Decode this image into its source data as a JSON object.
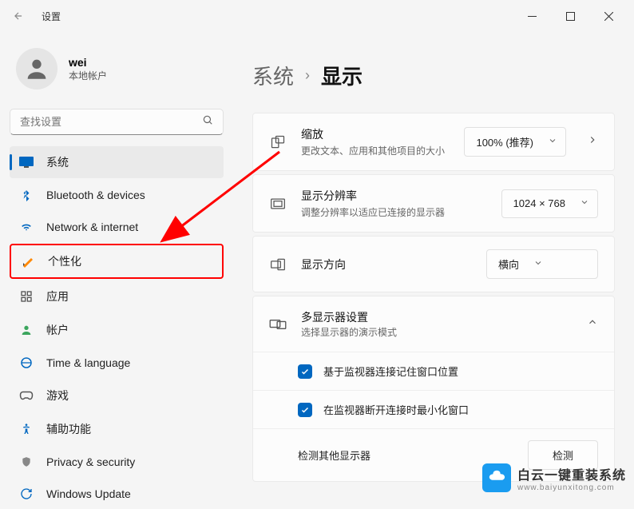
{
  "titlebar": {
    "title": "设置"
  },
  "user": {
    "name": "wei",
    "type": "本地帐户"
  },
  "search": {
    "placeholder": "查找设置"
  },
  "nav": {
    "items": [
      {
        "label": "系统",
        "active": true
      },
      {
        "label": "Bluetooth & devices"
      },
      {
        "label": "Network & internet"
      },
      {
        "label": "个性化",
        "highlighted": true
      },
      {
        "label": "应用"
      },
      {
        "label": "帐户"
      },
      {
        "label": "Time & language"
      },
      {
        "label": "游戏"
      },
      {
        "label": "辅助功能"
      },
      {
        "label": "Privacy & security"
      },
      {
        "label": "Windows Update"
      }
    ]
  },
  "breadcrumb": {
    "parent": "系统",
    "current": "显示"
  },
  "cards": {
    "scale": {
      "title": "缩放",
      "desc": "更改文本、应用和其他项目的大小",
      "value": "100% (推荐)"
    },
    "resolution": {
      "title": "显示分辨率",
      "desc": "调整分辨率以适应已连接的显示器",
      "value": "1024 × 768"
    },
    "orientation": {
      "title": "显示方向",
      "value": "横向"
    }
  },
  "multidisplay": {
    "title": "多显示器设置",
    "desc": "选择显示器的演示模式",
    "option1": "基于监视器连接记住窗口位置",
    "option2": "在监视器断开连接时最小化窗口",
    "detect_label": "检测其他显示器",
    "detect_button": "检测"
  },
  "watermark": {
    "main": "白云一键重装系统",
    "sub": "www.baiyunxitong.com"
  }
}
